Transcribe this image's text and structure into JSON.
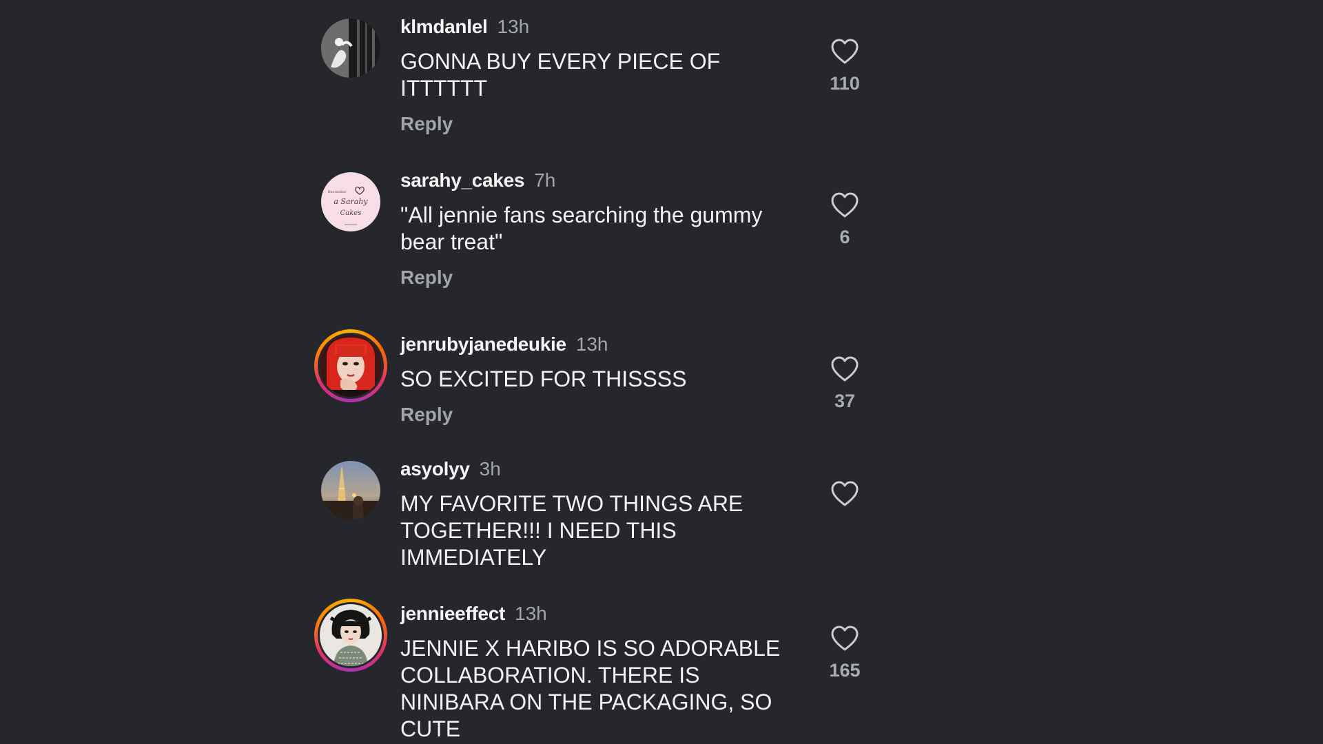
{
  "comments": [
    {
      "username": "klmdanlel",
      "time": "13h",
      "text": "GONNA BUY EVERY PIECE OF\nITTTTTT",
      "reply_label": "Reply",
      "likes": "110"
    },
    {
      "username": "sarahy_cakes",
      "time": "7h",
      "text": "\"All jennie fans searching the gummy\nbear treat\"",
      "reply_label": "Reply",
      "likes": "6"
    },
    {
      "username": "jenrubyjanedeukie",
      "time": "13h",
      "text": "SO EXCITED FOR THISSSS",
      "reply_label": "Reply",
      "likes": "37"
    },
    {
      "username": "asyolyy",
      "time": "3h",
      "text": "MY FAVORITE TWO THINGS ARE\nTOGETHER!!! I NEED THIS\nIMMEDIATELY",
      "likes": ""
    },
    {
      "username": "jennieeffect",
      "time": "13h",
      "text": "JENNIE X HARIBO IS SO ADORABLE\nCOLLABORATION. THERE IS\nNINIBARA ON THE PACKAGING, SO\nCUTE",
      "likes": "165"
    }
  ],
  "avatar_art": {
    "sarahy_cakes": [
      "Bienvenidos!",
      "a Sarahy",
      "Cakes"
    ]
  },
  "colors": {
    "background": "#25272c",
    "text": "#f3f3f3",
    "muted": "#a2a5ab",
    "story_ring": [
      "#f4b400",
      "#e1306c",
      "#a434b7"
    ]
  }
}
